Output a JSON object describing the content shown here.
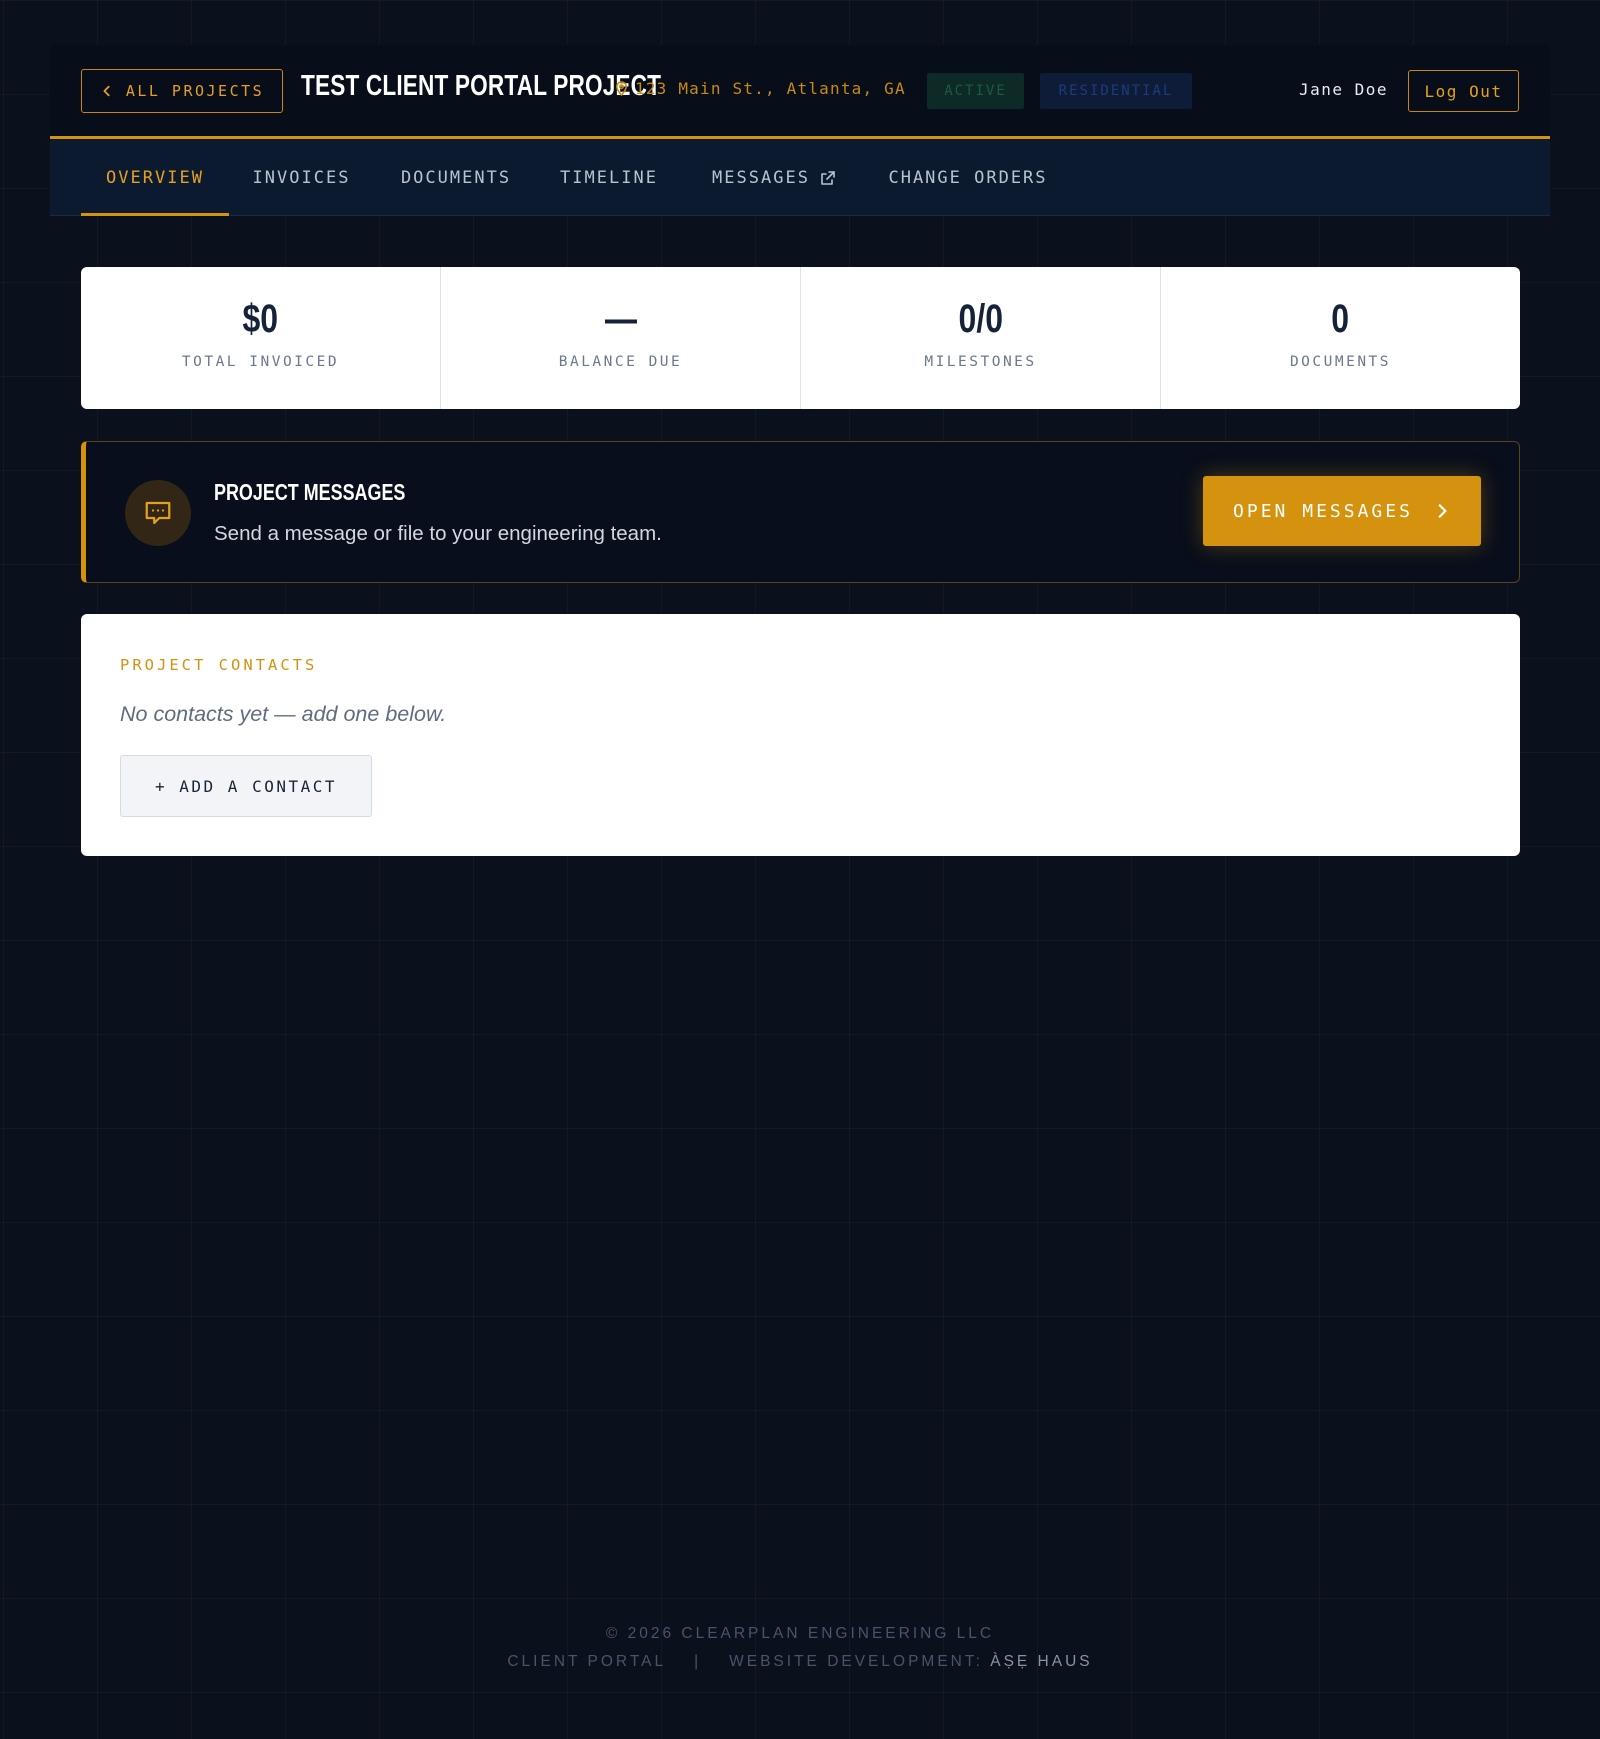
{
  "header": {
    "back_label": "ALL PROJECTS",
    "project_title": "TEST CLIENT PORTAL PROJECT",
    "address": "123 Main St., Atlanta, GA",
    "status_badge": "ACTIVE",
    "type_badge": "RESIDENTIAL",
    "user_name": "Jane Doe",
    "logout_label": "Log Out"
  },
  "nav": {
    "tabs": [
      {
        "label": "OVERVIEW",
        "active": true
      },
      {
        "label": "INVOICES",
        "active": false
      },
      {
        "label": "DOCUMENTS",
        "active": false
      },
      {
        "label": "TIMELINE",
        "active": false
      },
      {
        "label": "MESSAGES",
        "active": false,
        "icon": "external-link-icon"
      },
      {
        "label": "CHANGE ORDERS",
        "active": false
      }
    ]
  },
  "stats": [
    {
      "value": "$0",
      "label": "TOTAL INVOICED"
    },
    {
      "value": "—",
      "label": "BALANCE DUE"
    },
    {
      "value": "0/0",
      "label": "MILESTONES"
    },
    {
      "value": "0",
      "label": "DOCUMENTS"
    }
  ],
  "messages_card": {
    "icon": "chat-bubble-icon",
    "title": "PROJECT MESSAGES",
    "subtitle": "Send a message or file to your engineering team.",
    "button_label": "OPEN MESSAGES"
  },
  "contacts": {
    "heading": "PROJECT CONTACTS",
    "empty_text": "No contacts yet — add one below.",
    "add_button_label": "+ ADD A CONTACT"
  },
  "footer": {
    "copyright": "© 2026 CLEARPLAN ENGINEERING LLC",
    "portal_label": "CLIENT PORTAL",
    "separator": "|",
    "credit_prefix": "WEBSITE DEVELOPMENT:",
    "credit_name": "ÀṢẸ HAUS"
  },
  "colors": {
    "background": "#0b101d",
    "accent": "#d4920e",
    "header_bg": "#080d1a",
    "nav_bg": "#0c1a30",
    "card_bg": "#ffffff",
    "text_dark": "#15223a"
  }
}
